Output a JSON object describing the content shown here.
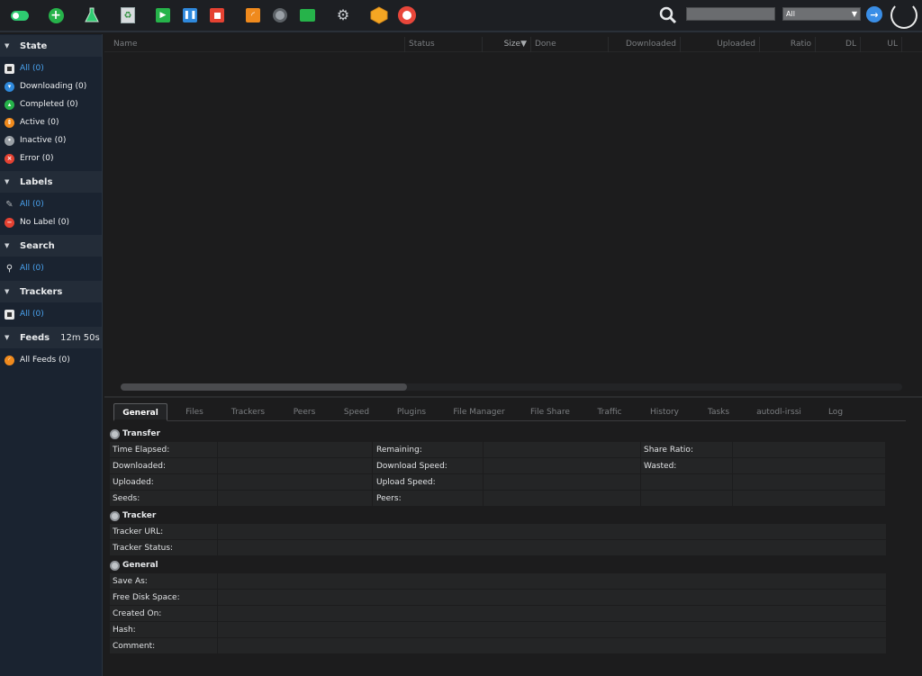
{
  "colors": {
    "accent": "#4aa3f0",
    "green": "#26b34a",
    "blue": "#2f89dc",
    "red": "#e54232",
    "orange": "#f08a1d"
  },
  "toolbar": {
    "icons": [
      "toggle-icon",
      "add-torrent-icon",
      "flask-icon",
      "recycle-icon",
      "start-icon",
      "pause-icon",
      "stop-icon",
      "rss-icon",
      "disk-icon",
      "chat-icon",
      "settings-gear-icon",
      "cube-icon",
      "lifebuoy-icon",
      "search-icon"
    ],
    "filter_value": "All"
  },
  "sidebar": {
    "state": {
      "title": "State",
      "items": [
        {
          "label": "All (0)"
        },
        {
          "label": "Downloading (0)"
        },
        {
          "label": "Completed (0)"
        },
        {
          "label": "Active (0)"
        },
        {
          "label": "Inactive (0)"
        },
        {
          "label": "Error (0)"
        }
      ]
    },
    "labels": {
      "title": "Labels",
      "items": [
        {
          "label": "All (0)"
        },
        {
          "label": "No Label (0)"
        }
      ]
    },
    "search": {
      "title": "Search",
      "items": [
        {
          "label": "All (0)"
        }
      ]
    },
    "trackers": {
      "title": "Trackers",
      "items": [
        {
          "label": "All (0)"
        }
      ]
    },
    "feeds": {
      "title": "Feeds",
      "timer": "12m 50s",
      "items": [
        {
          "label": "All Feeds (0)"
        }
      ]
    }
  },
  "list": {
    "columns": [
      "Name",
      "Status",
      "Size▼",
      "Done",
      "Downloaded",
      "Uploaded",
      "Ratio",
      "DL",
      "UL"
    ]
  },
  "details": {
    "tabs": [
      "General",
      "Files",
      "Trackers",
      "Peers",
      "Speed",
      "Plugins",
      "File Manager",
      "File Share",
      "Traffic",
      "History",
      "Tasks",
      "autodl-irssi",
      "Log"
    ],
    "transfer": {
      "title": "Transfer",
      "rows": [
        [
          "Time Elapsed:",
          "Remaining:",
          "Share Ratio:"
        ],
        [
          "Downloaded:",
          "Download Speed:",
          "Wasted:"
        ],
        [
          "Uploaded:",
          "Upload Speed:",
          ""
        ],
        [
          "Seeds:",
          "Peers:",
          ""
        ]
      ]
    },
    "tracker": {
      "title": "Tracker",
      "rows": [
        "Tracker URL:",
        "Tracker Status:"
      ]
    },
    "general": {
      "title": "General",
      "rows": [
        "Save As:",
        "Free Disk Space:",
        "Created On:",
        "Hash:",
        "Comment:"
      ]
    }
  }
}
